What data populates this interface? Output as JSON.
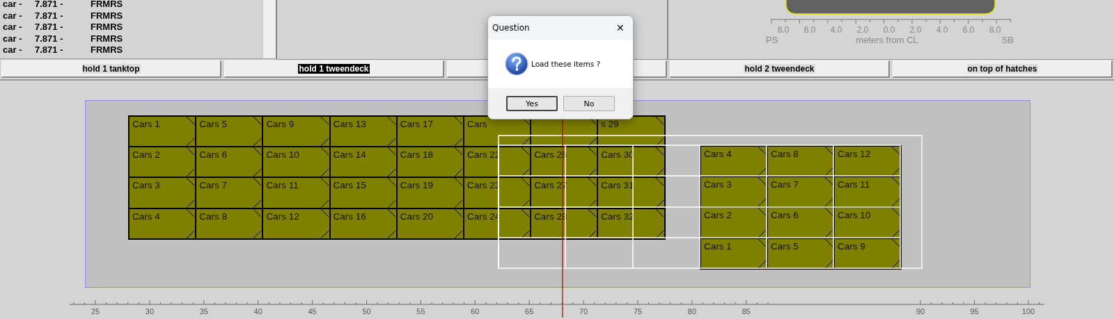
{
  "cargo_list": [
    {
      "type": "car -",
      "value": "7.871 -",
      "code": "FRMRS"
    },
    {
      "type": "car -",
      "value": "7.871 -",
      "code": "FRMRS"
    },
    {
      "type": "car -",
      "value": "7.871 -",
      "code": "FRMRS"
    },
    {
      "type": "car -",
      "value": "7.871 -",
      "code": "FRMRS"
    },
    {
      "type": "car -",
      "value": "7.871 -",
      "code": "FRMRS"
    }
  ],
  "gauge": {
    "ticks": [
      "8.0",
      "6.0",
      "4.0",
      "2.0",
      "0.0",
      "2.0",
      "4.0",
      "6.0",
      "8.0"
    ],
    "port_label": "PS",
    "axis_label": "meters from CL",
    "starboard_label": "SB"
  },
  "deck_tabs": [
    {
      "label": "hold 1 tanktop",
      "selected": false
    },
    {
      "label": "hold 1 tweendeck",
      "selected": true
    },
    {
      "selected": false
    },
    {
      "label": "hold 2 tweendeck",
      "selected": false
    },
    {
      "label": "on top of hatches",
      "selected": false
    }
  ],
  "left_block": {
    "columns": [
      [
        "Cars 1",
        "Cars 2",
        "Cars 3",
        "Cars 4"
      ],
      [
        "Cars 5",
        "Cars 6",
        "Cars 7",
        "Cars 8"
      ],
      [
        "Cars 9",
        "Cars 10",
        "Cars 11",
        "Cars 12"
      ],
      [
        "Cars 13",
        "Cars 14",
        "Cars 15",
        "Cars 16"
      ],
      [
        "Cars 17",
        "Cars 18",
        "Cars 19",
        "Cars 20"
      ],
      [
        "Cars",
        "Cars 22",
        "Cars 23",
        "Cars 24"
      ],
      [
        null,
        "Cars 26",
        "Cars 27",
        "Cars 28"
      ],
      [
        "s 29",
        "Cars 30",
        "Cars 31",
        "Cars 32"
      ]
    ]
  },
  "right_block": {
    "columns": [
      [
        "Cars 4",
        "Cars 3",
        "Cars 2",
        "Cars 1"
      ],
      [
        "Cars 8",
        "Cars 7",
        "Cars 6",
        "Cars 5"
      ],
      [
        "Cars 12",
        "Cars 11",
        "Cars 10",
        "Cars 9"
      ]
    ]
  },
  "ruler": {
    "labels": [
      "25",
      "30",
      "35",
      "40",
      "45",
      "50",
      "55",
      "60",
      "65",
      "70",
      "75",
      "80",
      "85",
      "90",
      "95",
      "100"
    ]
  },
  "dialog": {
    "title": "Question",
    "close": "✕",
    "message": "Load these items ?",
    "buttons": [
      {
        "label": "Yes",
        "selected": true
      },
      {
        "label": "No",
        "selected": false
      }
    ]
  }
}
